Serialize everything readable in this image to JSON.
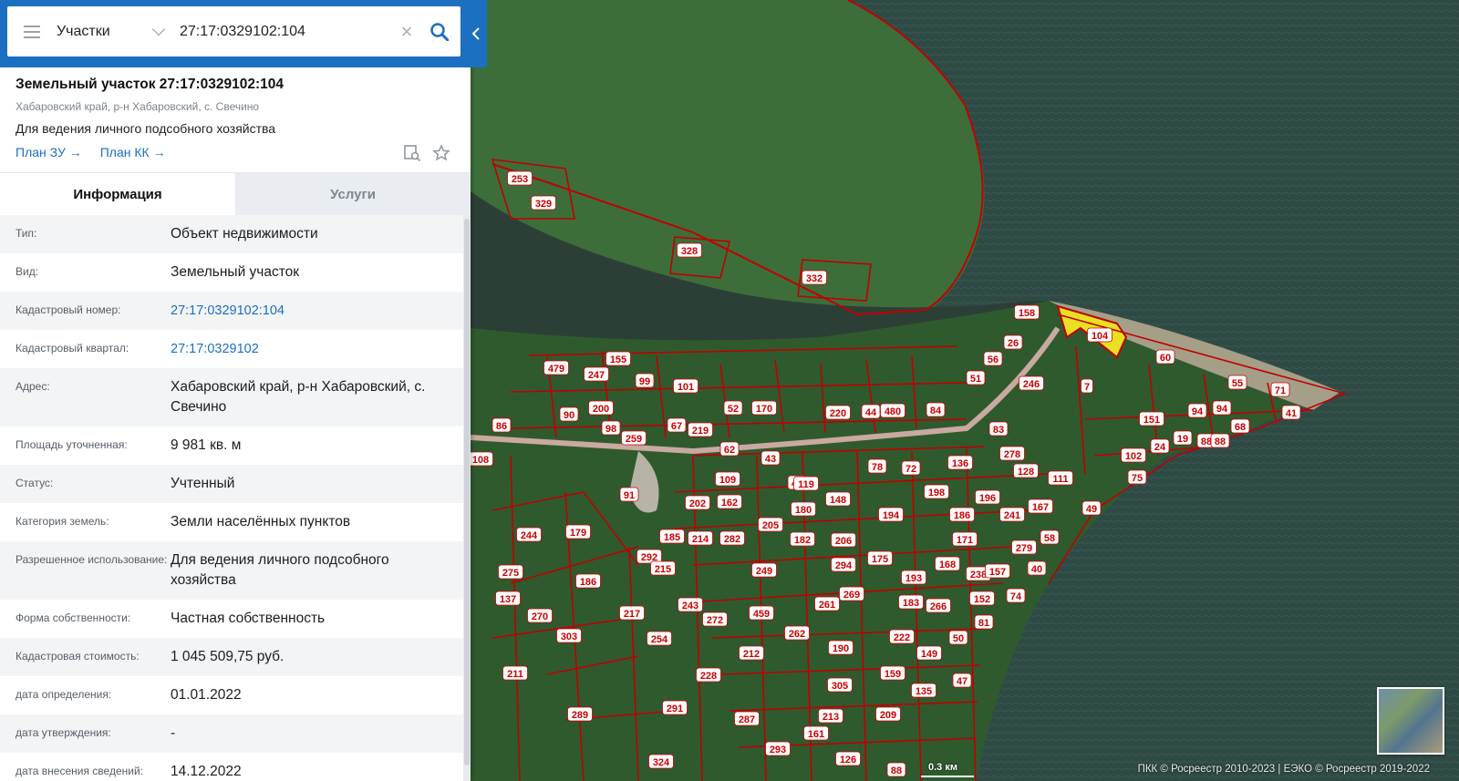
{
  "search": {
    "type_label": "Участки",
    "query": "27:17:0329102:104"
  },
  "card": {
    "title": "Земельный участок 27:17:0329102:104",
    "address": "Хабаровский край, р-н Хабаровский, с. Свечино",
    "purpose": "Для ведения личного подсобного хозяйства",
    "links": [
      "План ЗУ →",
      "План КК →"
    ]
  },
  "tabs": [
    {
      "label": "Информация",
      "active": true
    },
    {
      "label": "Услуги",
      "active": false
    }
  ],
  "info": [
    {
      "key": "Тип:",
      "value": "Объект недвижимости"
    },
    {
      "key": "Вид:",
      "value": "Земельный участок"
    },
    {
      "key": "Кадастровый номер:",
      "value": "27:17:0329102:104",
      "link": true
    },
    {
      "key": "Кадастровый квартал:",
      "value": "27:17:0329102",
      "link": true
    },
    {
      "key": "Адрес:",
      "value": "Хабаровский край, р-н Хабаровский, с. Свечино"
    },
    {
      "key": "Площадь уточненная:",
      "value": "9 981 кв. м"
    },
    {
      "key": "Статус:",
      "value": "Учтенный"
    },
    {
      "key": "Категория земель:",
      "value": "Земли населённых пунктов"
    },
    {
      "key": "Разрешенное использование:",
      "value": "Для ведения личного подсобного хозяйства"
    },
    {
      "key": "Форма собственности:",
      "value": "Частная собственность"
    },
    {
      "key": "Кадастровая стоимость:",
      "value": "1 045 509,75 руб."
    },
    {
      "key": "дата определения:",
      "value": "01.01.2022"
    },
    {
      "key": "дата утверждения:",
      "value": "-"
    },
    {
      "key": "дата внесения сведений:",
      "value": "14.12.2022"
    }
  ],
  "map": {
    "scale_label": "0.3 км",
    "attribution": "ПКК © Росреестр 2010-2023 | ЕЭКО © Росреестр 2019-2022",
    "parcel_labels": [
      "253",
      "329",
      "328",
      "332",
      "158",
      "104",
      "60",
      "56",
      "26",
      "51",
      "246",
      "7",
      "55",
      "71",
      "41",
      "94",
      "94",
      "151",
      "84",
      "83",
      "479",
      "155",
      "247",
      "99",
      "101",
      "52",
      "170",
      "220",
      "44",
      "480",
      "90",
      "200",
      "98",
      "259",
      "67",
      "219",
      "62",
      "43",
      "86",
      "108",
      "78",
      "72",
      "136",
      "278",
      "128",
      "111",
      "102",
      "75",
      "49",
      "88",
      "88",
      "68",
      "24",
      "19",
      "109",
      "45",
      "119",
      "91",
      "202",
      "162",
      "180",
      "148",
      "194",
      "198",
      "186",
      "196",
      "241",
      "167",
      "244",
      "179",
      "185",
      "214",
      "282",
      "205",
      "182",
      "206",
      "292",
      "215",
      "249",
      "294",
      "175",
      "193",
      "168",
      "171",
      "238",
      "157",
      "279",
      "58",
      "40",
      "275",
      "186",
      "137",
      "270",
      "303",
      "217",
      "243",
      "272",
      "459",
      "261",
      "269",
      "183",
      "266",
      "152",
      "74",
      "81",
      "254",
      "212",
      "262",
      "190",
      "222",
      "149",
      "50",
      "211",
      "228",
      "305",
      "159",
      "135",
      "47",
      "291",
      "287",
      "213",
      "209",
      "289",
      "293",
      "161",
      "126",
      "324",
      "88"
    ]
  },
  "colors": {
    "accent": "#1a6fc0",
    "parcel_border": "#c00000",
    "selected_parcel": "#e8e020"
  }
}
